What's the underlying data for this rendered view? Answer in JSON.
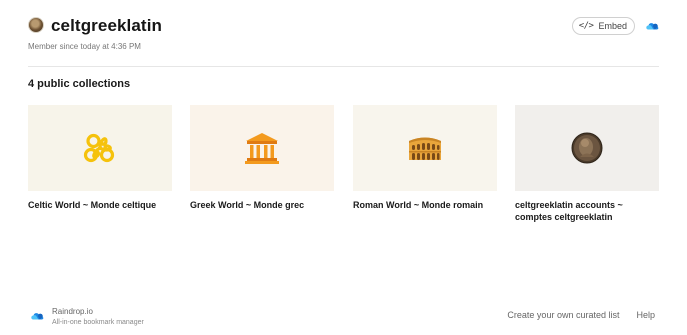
{
  "profile": {
    "username": "celtgreeklatin",
    "member_since": "Member since today at 4:36 PM"
  },
  "header": {
    "embed_icon": "</>",
    "embed_label": "Embed",
    "cloud_icon": "raindrop-cloud-icon"
  },
  "collections": {
    "heading": "4 public collections",
    "items": [
      {
        "title": "Celtic World ~ Monde celtique",
        "icon": "triskelion-icon",
        "bg": "#f7f4ea"
      },
      {
        "title": "Greek World ~ Monde grec",
        "icon": "greek-temple-icon",
        "bg": "#faf3ea"
      },
      {
        "title": "Roman World ~ Monde romain",
        "icon": "colosseum-icon",
        "bg": "#f8f5ed"
      },
      {
        "title": "celtgreeklatin accounts ~ comptes celtgreeklatin",
        "icon": "roman-coin-icon",
        "bg": "#f1efec"
      }
    ]
  },
  "footer": {
    "brand": "Raindrop.io",
    "tagline": "All-in-one bookmark manager",
    "link_create": "Create your own curated list",
    "link_help": "Help"
  },
  "colors": {
    "accent_blue": "#1e88e5",
    "triskele_yellow": "#f5c20c",
    "temple_orange": "#f39a1e"
  }
}
